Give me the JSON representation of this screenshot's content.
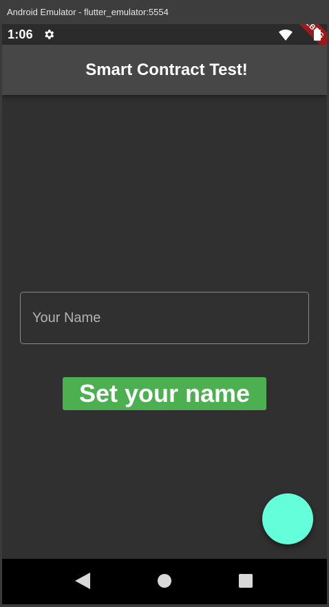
{
  "window": {
    "title": "Android Emulator - flutter_emulator:5554"
  },
  "status_bar": {
    "time": "1:06",
    "icons": [
      "gear-icon",
      "wifi-icon",
      "battery-icon"
    ]
  },
  "debug_banner": {
    "label": "DEBUG"
  },
  "app_bar": {
    "title": "Smart Contract Test!"
  },
  "form": {
    "name_placeholder": "Your Name",
    "name_value": "",
    "set_button_label": "Set your name"
  },
  "nav_bar": {
    "icons": [
      "back-icon",
      "home-icon",
      "recents-icon"
    ]
  },
  "colors": {
    "background": "#303030",
    "app_bar": "#474747",
    "button": "#4caf50",
    "fab": "#64ffda",
    "debug_banner": "#9b1b1b"
  }
}
